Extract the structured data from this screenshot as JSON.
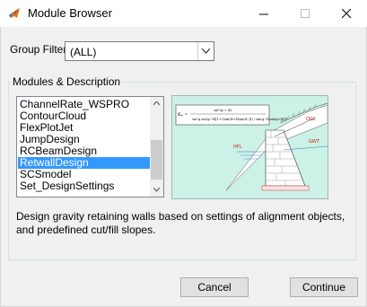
{
  "window": {
    "title": "Module Browser"
  },
  "group_filter": {
    "label": "Group Filter",
    "value": "(ALL)"
  },
  "modules": {
    "section_title": "Modules & Description",
    "items": [
      "ChannelRate_WSPRO",
      "ContourCloud",
      "FlexPlotJet",
      "JumpDesign",
      "RCBeamDesign",
      "RetwallDesign",
      "SCSmodel",
      "Set_DesignSettings"
    ],
    "selected": "RetwallDesign",
    "description": "Design gravity retaining walls based on settings of alignment objects, and predefined cut/fill slopes.",
    "preview": {
      "labels": {
        "ogl": "OGL",
        "gwt": "GWT",
        "hfl": "HFL"
      }
    }
  },
  "buttons": {
    "cancel": "Cancel",
    "continue": "Continue"
  },
  "colors": {
    "selection": "#3399ff",
    "preview_bg": "#ccf1e6"
  }
}
